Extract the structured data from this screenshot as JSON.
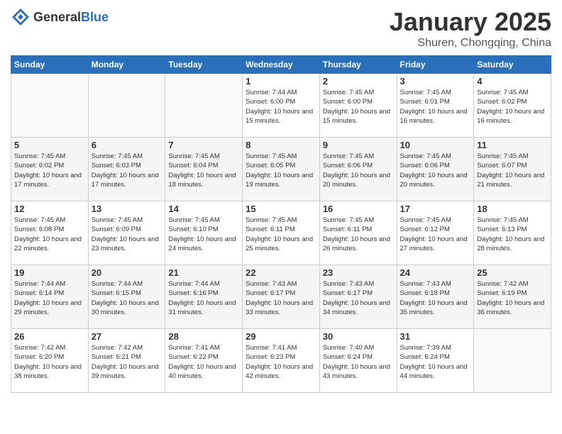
{
  "header": {
    "logo_general": "General",
    "logo_blue": "Blue",
    "month": "January 2025",
    "location": "Shuren, Chongqing, China"
  },
  "weekdays": [
    "Sunday",
    "Monday",
    "Tuesday",
    "Wednesday",
    "Thursday",
    "Friday",
    "Saturday"
  ],
  "weeks": [
    [
      {
        "day": "",
        "info": ""
      },
      {
        "day": "",
        "info": ""
      },
      {
        "day": "",
        "info": ""
      },
      {
        "day": "1",
        "info": "Sunrise: 7:44 AM\nSunset: 6:00 PM\nDaylight: 10 hours and 15 minutes."
      },
      {
        "day": "2",
        "info": "Sunrise: 7:45 AM\nSunset: 6:00 PM\nDaylight: 10 hours and 15 minutes."
      },
      {
        "day": "3",
        "info": "Sunrise: 7:45 AM\nSunset: 6:01 PM\nDaylight: 10 hours and 16 minutes."
      },
      {
        "day": "4",
        "info": "Sunrise: 7:45 AM\nSunset: 6:02 PM\nDaylight: 10 hours and 16 minutes."
      }
    ],
    [
      {
        "day": "5",
        "info": "Sunrise: 7:45 AM\nSunset: 6:02 PM\nDaylight: 10 hours and 17 minutes."
      },
      {
        "day": "6",
        "info": "Sunrise: 7:45 AM\nSunset: 6:03 PM\nDaylight: 10 hours and 17 minutes."
      },
      {
        "day": "7",
        "info": "Sunrise: 7:45 AM\nSunset: 6:04 PM\nDaylight: 10 hours and 18 minutes."
      },
      {
        "day": "8",
        "info": "Sunrise: 7:45 AM\nSunset: 6:05 PM\nDaylight: 10 hours and 19 minutes."
      },
      {
        "day": "9",
        "info": "Sunrise: 7:45 AM\nSunset: 6:06 PM\nDaylight: 10 hours and 20 minutes."
      },
      {
        "day": "10",
        "info": "Sunrise: 7:45 AM\nSunset: 6:06 PM\nDaylight: 10 hours and 20 minutes."
      },
      {
        "day": "11",
        "info": "Sunrise: 7:45 AM\nSunset: 6:07 PM\nDaylight: 10 hours and 21 minutes."
      }
    ],
    [
      {
        "day": "12",
        "info": "Sunrise: 7:45 AM\nSunset: 6:08 PM\nDaylight: 10 hours and 22 minutes."
      },
      {
        "day": "13",
        "info": "Sunrise: 7:45 AM\nSunset: 6:09 PM\nDaylight: 10 hours and 23 minutes."
      },
      {
        "day": "14",
        "info": "Sunrise: 7:45 AM\nSunset: 6:10 PM\nDaylight: 10 hours and 24 minutes."
      },
      {
        "day": "15",
        "info": "Sunrise: 7:45 AM\nSunset: 6:11 PM\nDaylight: 10 hours and 25 minutes."
      },
      {
        "day": "16",
        "info": "Sunrise: 7:45 AM\nSunset: 6:11 PM\nDaylight: 10 hours and 26 minutes."
      },
      {
        "day": "17",
        "info": "Sunrise: 7:45 AM\nSunset: 6:12 PM\nDaylight: 10 hours and 27 minutes."
      },
      {
        "day": "18",
        "info": "Sunrise: 7:45 AM\nSunset: 6:13 PM\nDaylight: 10 hours and 28 minutes."
      }
    ],
    [
      {
        "day": "19",
        "info": "Sunrise: 7:44 AM\nSunset: 6:14 PM\nDaylight: 10 hours and 29 minutes."
      },
      {
        "day": "20",
        "info": "Sunrise: 7:44 AM\nSunset: 6:15 PM\nDaylight: 10 hours and 30 minutes."
      },
      {
        "day": "21",
        "info": "Sunrise: 7:44 AM\nSunset: 6:16 PM\nDaylight: 10 hours and 31 minutes."
      },
      {
        "day": "22",
        "info": "Sunrise: 7:43 AM\nSunset: 6:17 PM\nDaylight: 10 hours and 33 minutes."
      },
      {
        "day": "23",
        "info": "Sunrise: 7:43 AM\nSunset: 6:17 PM\nDaylight: 10 hours and 34 minutes."
      },
      {
        "day": "24",
        "info": "Sunrise: 7:43 AM\nSunset: 6:18 PM\nDaylight: 10 hours and 35 minutes."
      },
      {
        "day": "25",
        "info": "Sunrise: 7:42 AM\nSunset: 6:19 PM\nDaylight: 10 hours and 36 minutes."
      }
    ],
    [
      {
        "day": "26",
        "info": "Sunrise: 7:42 AM\nSunset: 6:20 PM\nDaylight: 10 hours and 38 minutes."
      },
      {
        "day": "27",
        "info": "Sunrise: 7:42 AM\nSunset: 6:21 PM\nDaylight: 10 hours and 39 minutes."
      },
      {
        "day": "28",
        "info": "Sunrise: 7:41 AM\nSunset: 6:22 PM\nDaylight: 10 hours and 40 minutes."
      },
      {
        "day": "29",
        "info": "Sunrise: 7:41 AM\nSunset: 6:23 PM\nDaylight: 10 hours and 42 minutes."
      },
      {
        "day": "30",
        "info": "Sunrise: 7:40 AM\nSunset: 6:24 PM\nDaylight: 10 hours and 43 minutes."
      },
      {
        "day": "31",
        "info": "Sunrise: 7:39 AM\nSunset: 6:24 PM\nDaylight: 10 hours and 44 minutes."
      },
      {
        "day": "",
        "info": ""
      }
    ]
  ]
}
